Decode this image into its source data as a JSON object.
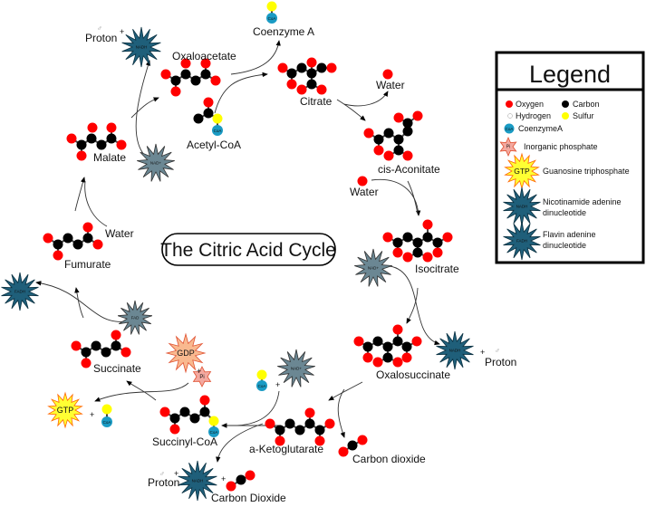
{
  "title": "The Citric Acid Cycle",
  "colors": {
    "oxygen": "#ff0000",
    "carbon": "#000000",
    "hydrogen": "#ffffff",
    "sulfur": "#ffff00",
    "coa": "#1a9bc4",
    "pi": "#f4a9a0",
    "gtp": "#ffff33",
    "gtp_border": "#ff6600",
    "gdp": "#f9b98f",
    "nadh": "#1f5f7a",
    "nad_plus": "#6b8793",
    "fad": "#6b8793"
  },
  "legend": {
    "title": "Legend",
    "items": [
      {
        "icon": "oxygen-atom",
        "label": "Oxygen"
      },
      {
        "icon": "carbon-atom",
        "label": "Carbon"
      },
      {
        "icon": "hydrogen-atom",
        "label": "Hydrogen"
      },
      {
        "icon": "sulfur-atom",
        "label": "Sulfur"
      },
      {
        "icon": "coa-molecule",
        "glyph": "CoA",
        "label": "CoenzymeA"
      },
      {
        "icon": "pi-star",
        "glyph": "Pi",
        "label": "Inorganic phosphate"
      },
      {
        "icon": "gtp-star",
        "glyph": "GTP",
        "label": "Guanosine triphosphate"
      },
      {
        "icon": "nadh-star",
        "glyph": "NADH",
        "label": "Nicotinamide adenine",
        "label2": "dinucleotide"
      },
      {
        "icon": "fadh-star",
        "glyph": "FADH",
        "label": "Flavin adenine",
        "label2": "dinucleotide"
      }
    ]
  },
  "molecules": {
    "oxaloacetate": "Oxaloacetate",
    "acetyl_coa": "Acetyl-CoA",
    "coenzyme_a": "Coenzyme A",
    "citrate": "Citrate",
    "water1": "Water",
    "cis_aconitate": "cis-Aconitate",
    "water2": "Water",
    "isocitrate": "Isocitrate",
    "oxalosuccinate": "Oxalosuccinate",
    "proton_right": "Proton",
    "carbon_dioxide1": "Carbon dioxide",
    "a_ketoglutarate": "a-Ketoglutarate",
    "succinyl_coa": "Succinyl-CoA",
    "proton_bottom": "Proton",
    "carbon_dioxide2": "Carbon Dioxide",
    "succinate": "Succinate",
    "fumurate": "Fumurate",
    "water3": "Water",
    "malate": "Malate",
    "proton_top": "Proton"
  },
  "cofactors": {
    "nadh": "NADH",
    "nad_plus": "NAD+",
    "fad": "FAD",
    "fadh": "FADH",
    "gdp": "GDP",
    "gtp": "GTP",
    "pi": "Pi",
    "coa": "CoA",
    "plus": "+",
    "proton_symbol": "♂"
  }
}
